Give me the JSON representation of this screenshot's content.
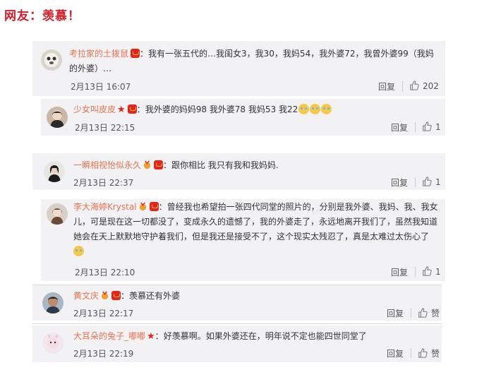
{
  "headline": "网友：羡慕！",
  "comments": [
    {
      "username": "考拉家的土拨鼠",
      "text_line1": "我有一张五代的…我闺女3，我30，我妈54，我外婆72，我曾外婆99（我妈",
      "text_line2": "的外婆）…",
      "time": "2月13日 16:07",
      "reply": "回复",
      "likes": "202"
    },
    {
      "username": "少女叫皮皮",
      "text": "我外婆的妈妈98 我外婆78 我妈53 我22",
      "time": "2月13日 22:15",
      "reply": "回复",
      "likes": "1"
    },
    {
      "username": "一瞬相视怡似永久",
      "text": "跟你相比  我只有我和我妈妈.",
      "time": "2月13日 22:37",
      "reply": "回复",
      "likes": "1"
    },
    {
      "username": "李大海婷Krystal",
      "text_line1": "曾经我也希望拍一张四代同堂的照片的，分别是我外婆、我妈、我、我女",
      "text_line2": "儿，可是现在这一切都没了，变成永久的遗憾了，我的外婆走了，永远地离开我们了，虽然我知道",
      "text_line3": "她会在天上默默地守护着我们，但是我还是接受不了，这个现实太残忍了，真是太难过太伤心了",
      "time": "2月13日 22:10",
      "reply": "回复",
      "likes": "1"
    },
    {
      "username": "黄文庆",
      "text": "羡慕还有外婆",
      "time": "2月13日 22:17",
      "reply": "回复",
      "likes": "赞"
    },
    {
      "username": "大耳朵的兔子_嘟嘟",
      "text": "好羡慕啊。如果外婆还在，明年说不定也能四世同堂了",
      "time": "2月13日 22:19",
      "reply": "回复",
      "likes": "赞"
    }
  ],
  "colors": {
    "headline": "#d1202a",
    "username": "#eb7350",
    "card_bg": "#f2f2f5"
  }
}
